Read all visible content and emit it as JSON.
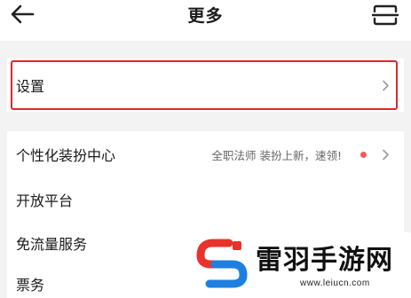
{
  "header": {
    "title": "更多",
    "back_icon": "arrow-left-icon",
    "scan_icon": "scan-icon"
  },
  "settings": {
    "label": "设置",
    "highlight_color": "#e0262f"
  },
  "menu": {
    "skin_center": {
      "label": "个性化装扮中心",
      "promo": "全职法师 装扮上新，速领!",
      "dot_color": "#f25a5a"
    },
    "open_platform": {
      "label": "开放平台"
    },
    "traffic_service": {
      "label": "免流量服务"
    },
    "tickets": {
      "label": "票务"
    }
  },
  "watermark": {
    "text": "雷羽手游网",
    "url": "www.leiucn.com",
    "logo_colors": [
      "#e8332c",
      "#1f7fe0"
    ]
  }
}
